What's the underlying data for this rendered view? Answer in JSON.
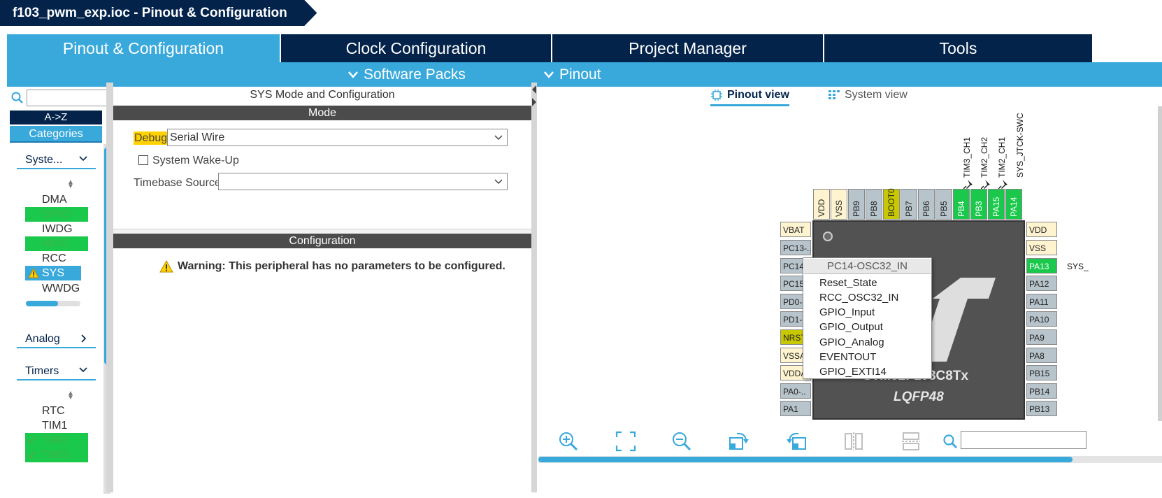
{
  "window": {
    "title": "f103_pwm_exp.ioc - Pinout & Configuration"
  },
  "tabs": [
    {
      "label": "Pinout & Configuration",
      "active": true
    },
    {
      "label": "Clock Configuration",
      "active": false
    },
    {
      "label": "Project Manager",
      "active": false
    },
    {
      "label": "Tools",
      "active": false
    }
  ],
  "subbar": {
    "software_packs": "Software Packs",
    "pinout": "Pinout"
  },
  "left": {
    "search_placeholder": "",
    "az_label": "A->Z",
    "categories_label": "Categories",
    "groups": {
      "system": {
        "label": "Syste...",
        "items": [
          {
            "label": "DMA",
            "state": "normal"
          },
          {
            "label": "GPIO",
            "state": "green"
          },
          {
            "label": "IWDG",
            "state": "normal"
          },
          {
            "label": "NVIC",
            "state": "green"
          },
          {
            "label": "RCC",
            "state": "normal"
          },
          {
            "label": "SYS",
            "state": "selected-warning"
          },
          {
            "label": "WWDG",
            "state": "normal"
          }
        ]
      },
      "analog": {
        "label": "Analog"
      },
      "timers": {
        "label": "Timers",
        "items": [
          {
            "label": "RTC",
            "state": "normal"
          },
          {
            "label": "TIM1",
            "state": "normal"
          },
          {
            "label": "TIM2",
            "state": "checked"
          },
          {
            "label": "TIM3",
            "state": "checked"
          }
        ]
      }
    }
  },
  "center": {
    "title": "SYS Mode and Configuration",
    "mode_header": "Mode",
    "debug_label": "Debug",
    "debug_value": "Serial Wire",
    "wakeup_label": "System Wake-Up",
    "wakeup_checked": false,
    "timebase_label": "Timebase Source",
    "timebase_value": "",
    "config_header": "Configuration",
    "warning_text": "Warning: This peripheral has no parameters to be configured."
  },
  "right": {
    "pinout_view_label": "Pinout view",
    "system_view_label": "System view",
    "top_pins": [
      {
        "name": "VDD",
        "color": "cream"
      },
      {
        "name": "VSS",
        "color": "cream"
      },
      {
        "name": "PB9",
        "color": "grey"
      },
      {
        "name": "PB8",
        "color": "grey"
      },
      {
        "name": "BOOT0",
        "color": "olive"
      },
      {
        "name": "PB7",
        "color": "grey"
      },
      {
        "name": "PB6",
        "color": "grey"
      },
      {
        "name": "PB5",
        "color": "grey"
      },
      {
        "name": "PB4",
        "color": "green"
      },
      {
        "name": "PB3",
        "color": "green"
      },
      {
        "name": "PA15",
        "color": "green"
      },
      {
        "name": "PA14",
        "color": "green"
      }
    ],
    "top_signals": [
      "TIM3_CH1",
      "TIM2_CH2",
      "TIM2_CH1",
      "SYS_JTCK-SWC"
    ],
    "left_pins": [
      {
        "name": "VBAT",
        "color": "cream"
      },
      {
        "name": "PC13-..",
        "color": "grey"
      },
      {
        "name": "PC14",
        "color": "grey"
      },
      {
        "name": "PC15",
        "color": "grey"
      },
      {
        "name": "PD0-",
        "color": "grey"
      },
      {
        "name": "PD1-",
        "color": "grey"
      },
      {
        "name": "NRST",
        "color": "olive"
      },
      {
        "name": "VSSA",
        "color": "cream"
      },
      {
        "name": "VDDA",
        "color": "cream"
      },
      {
        "name": "PA0-..",
        "color": "grey"
      },
      {
        "name": "PA1",
        "color": "grey"
      }
    ],
    "right_pins": [
      {
        "name": "VDD",
        "color": "cream"
      },
      {
        "name": "VSS",
        "color": "cream"
      },
      {
        "name": "PA13",
        "color": "green"
      },
      {
        "name": "PA12",
        "color": "grey"
      },
      {
        "name": "PA11",
        "color": "grey"
      },
      {
        "name": "PA10",
        "color": "grey"
      },
      {
        "name": "PA9",
        "color": "grey"
      },
      {
        "name": "PA8",
        "color": "grey"
      },
      {
        "name": "PB15",
        "color": "grey"
      },
      {
        "name": "PB14",
        "color": "grey"
      },
      {
        "name": "PB13",
        "color": "grey"
      }
    ],
    "right_signal": "SYS_",
    "chip_name": "STM32F103C8Tx",
    "chip_name_visible": "STM32F103C8Tx",
    "chip_package": "LQFP48",
    "context_menu": {
      "header": "PC14-OSC32_IN",
      "items": [
        "Reset_State",
        "RCC_OSC32_IN",
        "GPIO_Input",
        "GPIO_Output",
        "GPIO_Analog",
        "EVENTOUT",
        "GPIO_EXTI14"
      ]
    },
    "toolbar_icons": [
      "zoom-in-icon",
      "fit-icon",
      "zoom-out-icon",
      "rotate-right-icon",
      "rotate-left-icon",
      "flip-vertical-icon",
      "flip-horizontal-icon",
      "search-icon"
    ],
    "search_value": ""
  },
  "colors": {
    "navy": "#03234b",
    "accent": "#39a9dc",
    "pin_green": "#1ac84b",
    "pin_olive": "#c8c800",
    "pin_cream": "#fff4cf",
    "pin_grey": "#b8c4cc",
    "warning_yellow": "#ffd200"
  }
}
